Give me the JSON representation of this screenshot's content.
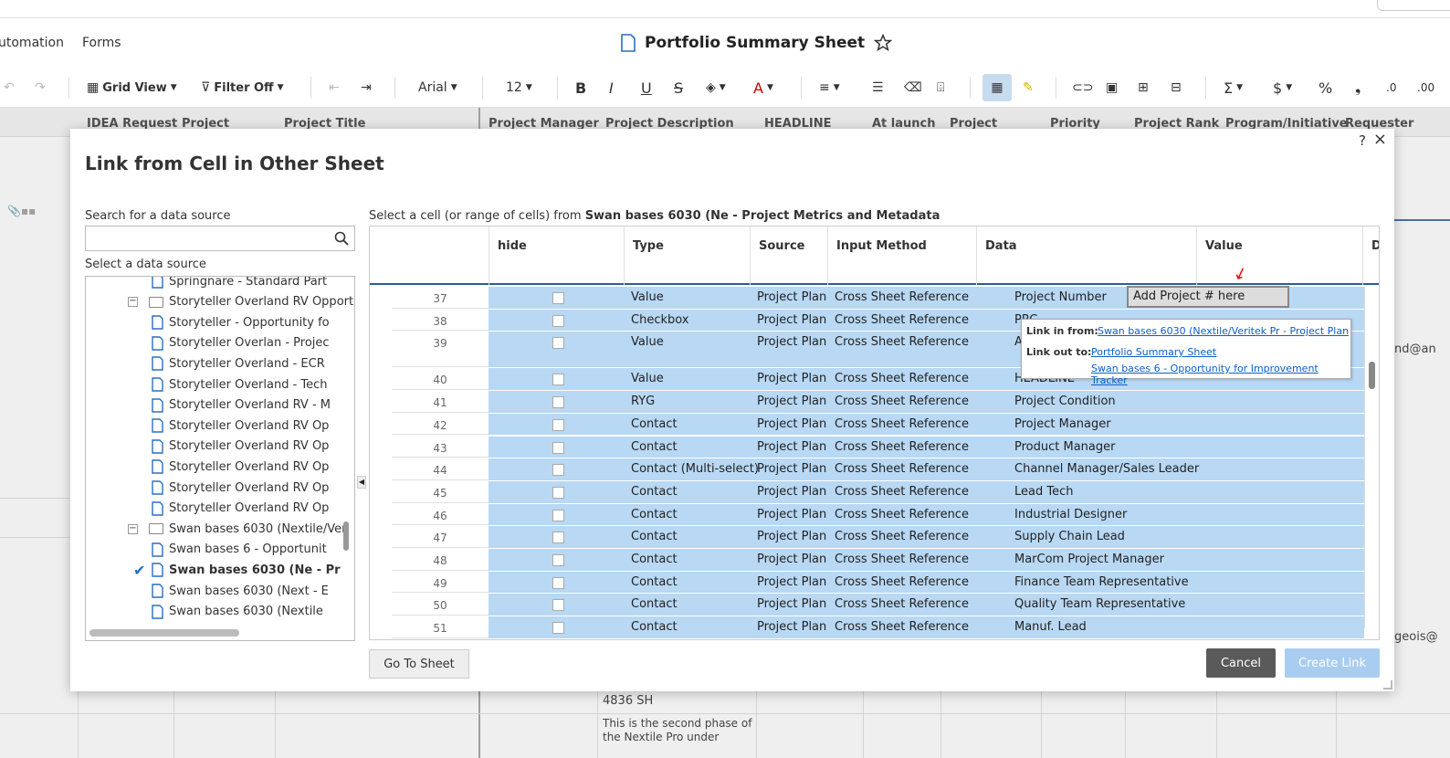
{
  "app": {
    "menu": [
      "utomation",
      "Forms"
    ],
    "doc_title": "Portfolio Summary Sheet"
  },
  "toolbar": {
    "grid_view": "Grid View",
    "filter": "Filter Off",
    "font": "Arial",
    "size": "12"
  },
  "background": {
    "headers": [
      "IDEA Request",
      "Project",
      "Project Title",
      "Project Manager",
      "Project Description",
      "HEADLINE",
      "At launch",
      "Project",
      "Priority",
      "Project Rank",
      "Program/Initiative",
      "Requester"
    ],
    "cell_4836": "4836 SH",
    "cell_desc": "This is the second phase of the Nextile Pro under",
    "email1": "nd@an",
    "email2": "geois@"
  },
  "dialog": {
    "title": "Link from Cell in Other Sheet",
    "help": "?",
    "close": "×",
    "search_label": "Search for a data source",
    "search_value": "",
    "select_label": "Select a data source",
    "source_prefix": "Select a cell (or range of cells) from",
    "source_name": "Swan bases 6030 (Ne - Project Metrics and Metadata",
    "tree": [
      {
        "label": "Springnare - Standard Part",
        "type": "sheet",
        "indent": 2
      },
      {
        "label": "Storyteller Overland RV Opport",
        "type": "folder",
        "indent": 1
      },
      {
        "label": "Storyteller - Opportunity fo",
        "type": "sheet",
        "indent": 2
      },
      {
        "label": "Storyteller Overlan - Projec",
        "type": "sheet",
        "indent": 2
      },
      {
        "label": "Storyteller Overland - ECR",
        "type": "sheet",
        "indent": 2
      },
      {
        "label": "Storyteller Overland - Tech",
        "type": "sheet",
        "indent": 2
      },
      {
        "label": "Storyteller Overland RV - M",
        "type": "sheet",
        "indent": 2
      },
      {
        "label": "Storyteller Overland RV Op",
        "type": "sheet",
        "indent": 2
      },
      {
        "label": "Storyteller Overland RV Op",
        "type": "sheet",
        "indent": 2
      },
      {
        "label": "Storyteller Overland RV Op",
        "type": "sheet",
        "indent": 2
      },
      {
        "label": "Storyteller Overland RV Op",
        "type": "sheet",
        "indent": 2
      },
      {
        "label": "Storyteller Overland RV Op",
        "type": "sheet",
        "indent": 2
      },
      {
        "label": "Swan bases 6030 (Nextile/Veri",
        "type": "folder",
        "indent": 1
      },
      {
        "label": "Swan bases 6 - Opportunit",
        "type": "sheet",
        "indent": 2
      },
      {
        "label": "Swan bases 6030 (Ne - Pr",
        "type": "sheet",
        "indent": 2,
        "selected": true
      },
      {
        "label": "Swan bases 6030 (Next - E",
        "type": "sheet",
        "indent": 2
      },
      {
        "label": "Swan bases 6030 (Nextile",
        "type": "sheet",
        "indent": 2
      }
    ],
    "grid_headers": [
      "hide",
      "Type",
      "Source",
      "Input Method",
      "Data",
      "Value",
      "D"
    ],
    "rows": [
      {
        "n": "37",
        "type": "Value",
        "source": "Project Plan",
        "method": "Cross Sheet Reference",
        "data": "Project Number"
      },
      {
        "n": "38",
        "type": "Checkbox",
        "source": "Project Plan",
        "method": "Cross Sheet Reference",
        "data": "PRC"
      },
      {
        "n": "39",
        "type": "Value",
        "source": "Project Plan",
        "method": "Cross Sheet Reference",
        "data": "A"
      },
      {
        "n": "40",
        "type": "Value",
        "source": "Project Plan",
        "method": "Cross Sheet Reference",
        "data": "HEADLINE"
      },
      {
        "n": "41",
        "type": "RYG",
        "source": "Project Plan",
        "method": "Cross Sheet Reference",
        "data": "Project Condition"
      },
      {
        "n": "42",
        "type": "Contact",
        "source": "Project Plan",
        "method": "Cross Sheet Reference",
        "data": "Project Manager"
      },
      {
        "n": "43",
        "type": "Contact",
        "source": "Project Plan",
        "method": "Cross Sheet Reference",
        "data": "Product Manager"
      },
      {
        "n": "44",
        "type": "Contact (Multi-select)",
        "source": "Project Plan",
        "method": "Cross Sheet Reference",
        "data": "Channel Manager/Sales Leader"
      },
      {
        "n": "45",
        "type": "Contact",
        "source": "Project Plan",
        "method": "Cross Sheet Reference",
        "data": "Lead Tech"
      },
      {
        "n": "46",
        "type": "Contact",
        "source": "Project Plan",
        "method": "Cross Sheet Reference",
        "data": "Industrial Designer"
      },
      {
        "n": "47",
        "type": "Contact",
        "source": "Project Plan",
        "method": "Cross Sheet Reference",
        "data": "Supply Chain Lead"
      },
      {
        "n": "48",
        "type": "Contact",
        "source": "Project Plan",
        "method": "Cross Sheet Reference",
        "data": "MarCom Project Manager"
      },
      {
        "n": "49",
        "type": "Contact",
        "source": "Project Plan",
        "method": "Cross Sheet Reference",
        "data": "Finance Team Representative"
      },
      {
        "n": "50",
        "type": "Contact",
        "source": "Project Plan",
        "method": "Cross Sheet Reference",
        "data": "Quality Team Representative"
      },
      {
        "n": "51",
        "type": "Contact",
        "source": "Project Plan",
        "method": "Cross Sheet Reference",
        "data": "Manuf. Lead"
      }
    ],
    "value_cell": "Add Project # here",
    "tooltip": {
      "link_in_label": "Link in from:",
      "link_in": "Swan bases 6030 (Nextile/Veritek Pr - Project Plan",
      "link_out_label": "Link out to:",
      "link_out_1": "Portfolio Summary Sheet",
      "link_out_2": "Swan bases 6 - Opportunity for Improvement Tracker"
    },
    "go_to_sheet": "Go To Sheet",
    "cancel": "Cancel",
    "create_link": "Create Link"
  },
  "colors": {
    "selection": "#b8d8f4",
    "link": "#0b5fcc",
    "cancel_bg": "#5a5a5a",
    "create_bg": "#a9cdf0"
  }
}
